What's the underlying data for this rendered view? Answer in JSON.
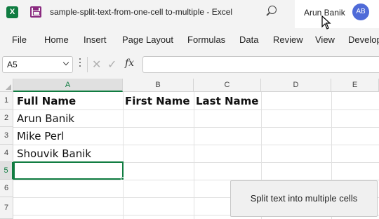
{
  "titlebar": {
    "logo": "X",
    "logo_icon": "excel-logo-icon",
    "save_icon": "save-icon",
    "document_title": "sample-split-text-from-one-cell to-multiple  -  Excel",
    "search_icon": "search-icon",
    "user_name": "Arun Banik",
    "avatar_initials": "AB"
  },
  "menu": {
    "items": [
      "File",
      "Home",
      "Insert",
      "Page Layout",
      "Formulas",
      "Data",
      "Review",
      "View",
      "Develop"
    ]
  },
  "formula_bar": {
    "name_box": "A5",
    "cancel_symbol": "✕",
    "enter_symbol": "✓",
    "fx_label": "fx",
    "formula_value": ""
  },
  "sheet": {
    "columns": [
      "A",
      "B",
      "C",
      "D",
      "E"
    ],
    "rows": [
      "1",
      "2",
      "3",
      "4",
      "5",
      "6",
      "7"
    ],
    "selected_cell": "A5",
    "cells": {
      "A1": "Full Name",
      "B1": "First Name",
      "C1": "Last Name",
      "A2": "Arun Banik",
      "A3": "Mike Perl",
      "A4": "Shouvik Banik"
    }
  },
  "callout": {
    "label": "Split text into multiple cells"
  },
  "colors": {
    "excel_green": "#107c41",
    "avatar_blue": "#4f6bd8",
    "save_purple": "#8a2a7f"
  }
}
